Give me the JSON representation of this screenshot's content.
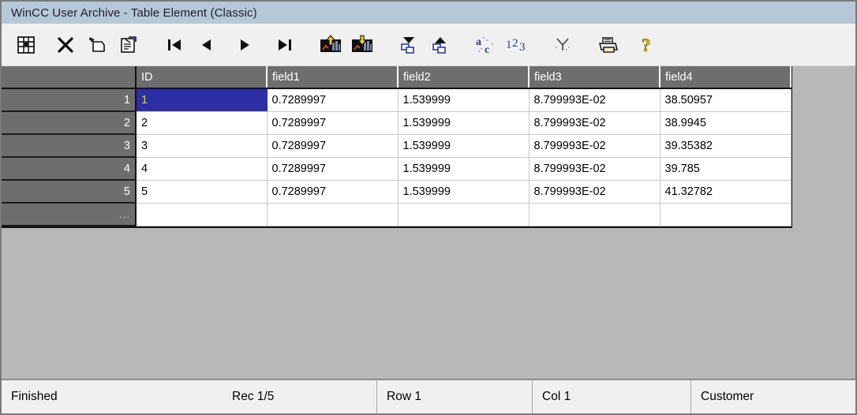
{
  "window": {
    "title": "WinCC User Archive - Table Element (Classic)"
  },
  "toolbar": {
    "buttons": [
      {
        "name": "table-view-icon",
        "label": "Table View"
      },
      {
        "name": "delete-record-icon",
        "label": "Delete Record"
      },
      {
        "name": "new-record-icon",
        "label": "New Record"
      },
      {
        "name": "properties-icon",
        "label": "Properties"
      },
      {
        "name": "first-record-icon",
        "label": "First Record"
      },
      {
        "name": "previous-record-icon",
        "label": "Previous Record"
      },
      {
        "name": "next-record-icon",
        "label": "Next Record"
      },
      {
        "name": "last-record-icon",
        "label": "Last Record"
      },
      {
        "name": "import-icon",
        "label": "Import"
      },
      {
        "name": "export-icon",
        "label": "Export"
      },
      {
        "name": "filter-descending-icon",
        "label": "Filter Descending"
      },
      {
        "name": "filter-ascending-icon",
        "label": "Filter Ascending"
      },
      {
        "name": "sort-alpha-icon",
        "label": "Sort Alphabetical"
      },
      {
        "name": "sort-numeric-icon",
        "label": "Sort Numeric"
      },
      {
        "name": "hide-columns-icon",
        "label": "Hide Columns"
      },
      {
        "name": "print-icon",
        "label": "Print"
      },
      {
        "name": "help-icon",
        "label": "Help"
      }
    ]
  },
  "grid": {
    "columns": [
      "ID",
      "field1",
      "field2",
      "field3",
      "field4"
    ],
    "row_headers": [
      "1",
      "2",
      "3",
      "4",
      "5",
      "..."
    ],
    "rows": [
      {
        "id": "1",
        "field1": "0.7289997",
        "field2": "1.539999",
        "field3": "8.799993E-02",
        "field4": "38.50957"
      },
      {
        "id": "2",
        "field1": "0.7289997",
        "field2": "1.539999",
        "field3": "8.799993E-02",
        "field4": "38.9945"
      },
      {
        "id": "3",
        "field1": "0.7289997",
        "field2": "1.539999",
        "field3": "8.799993E-02",
        "field4": "39.35382"
      },
      {
        "id": "4",
        "field1": "0.7289997",
        "field2": "1.539999",
        "field3": "8.799993E-02",
        "field4": "39.785"
      },
      {
        "id": "5",
        "field1": "0.7289997",
        "field2": "1.539999",
        "field3": "8.799993E-02",
        "field4": "41.32782"
      },
      {
        "id": "",
        "field1": "",
        "field2": "",
        "field3": "",
        "field4": ""
      }
    ],
    "selected_cell": {
      "row": 0,
      "column": "ID",
      "value": "1"
    },
    "colors": {
      "header_background": "#6e6e6e",
      "selection_background": "#2d2da4",
      "selection_text": "#cfdc4e"
    }
  },
  "statusbar": {
    "state": "Finished",
    "record": "Rec 1/5",
    "row": "Row 1",
    "col": "Col 1",
    "archive": "Customer"
  }
}
